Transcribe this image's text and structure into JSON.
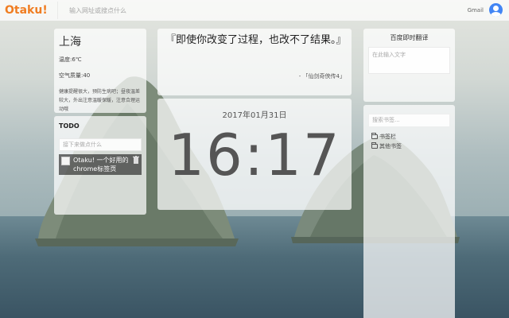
{
  "app": {
    "logo": "Otaku!"
  },
  "topbar": {
    "search_placeholder": "输入网址或搜点什么",
    "gmail_label": "Gmail"
  },
  "weather": {
    "city": "上海",
    "temperature": "温度:6℃",
    "air_quality": "空气质量:40",
    "advice": "健康提醒很大，预防生病吧；昼夜温差较大，外出注意温暖保暖，注意合理运动哦"
  },
  "todo": {
    "title": "TODO",
    "input_placeholder": "接下来做点什么",
    "items": [
      {
        "text": "Otaku! 一个好用的chrome标签页"
      }
    ]
  },
  "quote": {
    "text": "『即使你改变了过程，也改不了结果。』",
    "source": "- 「仙剑奇侠传4」"
  },
  "clock": {
    "date": "2017年01月31日",
    "time": "16:17"
  },
  "translate": {
    "title": "百度即时翻译",
    "input_placeholder": "在此输入文字"
  },
  "bookmarks": {
    "search_placeholder": "搜索书签...",
    "folders": [
      {
        "label": "书签栏"
      },
      {
        "label": "其他书签"
      }
    ]
  },
  "colors": {
    "brand": "#f07d22",
    "avatar": "#4285f4"
  }
}
